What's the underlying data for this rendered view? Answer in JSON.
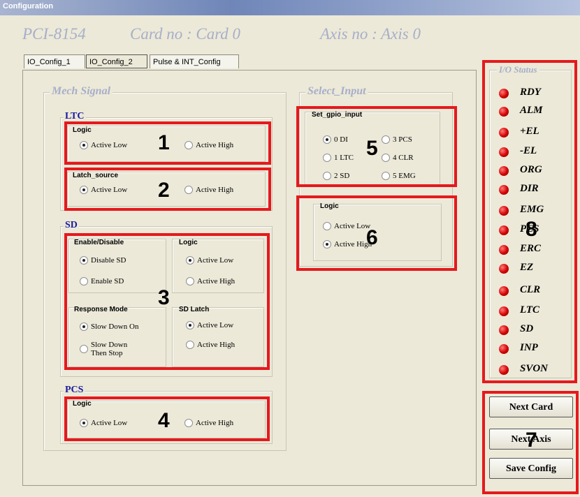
{
  "window": {
    "title": "Configuration"
  },
  "header": {
    "model": "PCI-8154",
    "card": "Card no : Card  0",
    "axis": "Axis no : Axis  0"
  },
  "tabs": [
    "IO_Config_1",
    "IO_Config_2",
    "Pulse & INT_Config"
  ],
  "mech_signal": {
    "title": "Mech Signal",
    "ltc": {
      "title": "LTC",
      "logic": {
        "label": "Logic",
        "options": [
          "Active Low",
          "Active High"
        ]
      },
      "latch_source": {
        "label": "Latch_source",
        "options": [
          "Active Low",
          "Active High"
        ]
      }
    },
    "sd": {
      "title": "SD",
      "enable": {
        "label": "Enable/Disable",
        "options": [
          "Disable SD",
          "Enable SD"
        ]
      },
      "logic": {
        "label": "Logic",
        "options": [
          "Active Low",
          "Active High"
        ]
      },
      "response": {
        "label": "Response Mode",
        "options": [
          "Slow Down On",
          "Slow Down",
          "Then Stop"
        ]
      },
      "latch": {
        "label": "SD Latch",
        "options": [
          "Active Low",
          "Active High"
        ]
      }
    },
    "pcs": {
      "title": "PCS",
      "logic": {
        "label": "Logic",
        "options": [
          "Active Low",
          "Active High"
        ]
      }
    }
  },
  "select_input": {
    "title": "Select_Input",
    "gpio": {
      "label": "Set_gpio_input",
      "options": [
        "0 DI",
        "3 PCS",
        "1 LTC",
        "4 CLR",
        "2 SD",
        "5 EMG"
      ]
    },
    "logic": {
      "label": "Logic",
      "options": [
        "Active Low",
        "Active High"
      ]
    }
  },
  "io_status": {
    "title": "I/O Status",
    "items": [
      "RDY",
      "ALM",
      "+EL",
      "-EL",
      "ORG",
      "DIR",
      "EMG",
      "PCS",
      "ERC",
      "EZ",
      "CLR",
      "LTC",
      "SD",
      "INP",
      "SVON"
    ],
    "led_color": "#d40000"
  },
  "buttons": {
    "next_card": "Next Card",
    "next_axis": "Next Axis",
    "save_config": "Save Config"
  },
  "annotations": [
    "1",
    "2",
    "3",
    "4",
    "5",
    "6",
    "7",
    "8"
  ],
  "colors": {
    "annotation_box": "#e5191d",
    "header_text": "#a7aec9",
    "subgroup_text": "#1a1aa0"
  }
}
